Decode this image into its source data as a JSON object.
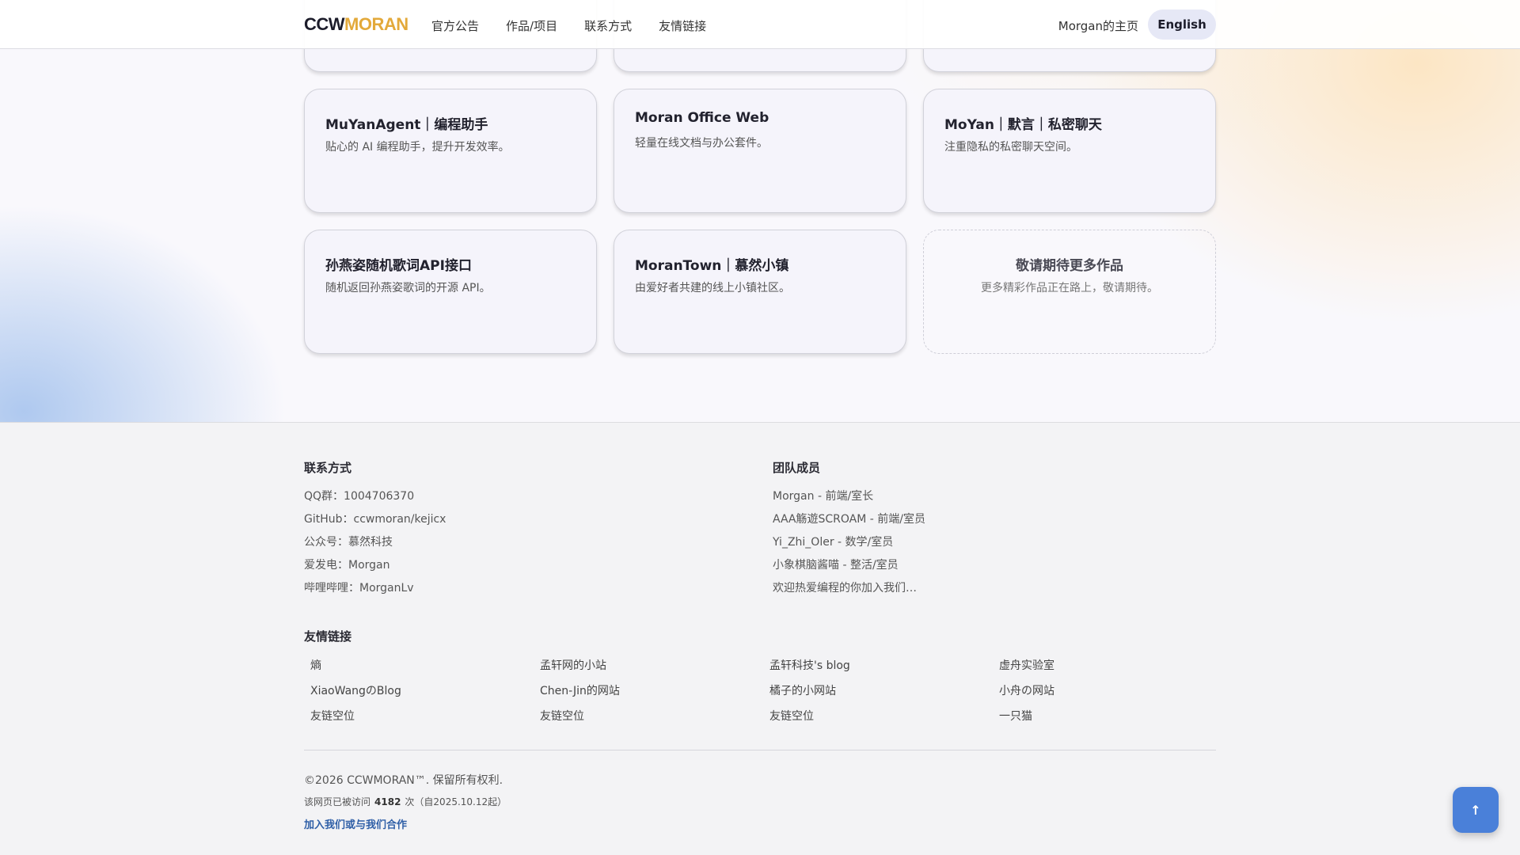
{
  "header": {
    "logo_part1": "CCW",
    "logo_part2": "MORAN",
    "nav": [
      "官方公告",
      "作品/项目",
      "联系方式",
      "友情链接"
    ],
    "home_link": "Morgan的主页",
    "lang_button": "English"
  },
  "projects": [
    {
      "title": "MuYanAgent｜编程助手",
      "desc": "贴心的 AI 编程助手，提升开发效率。"
    },
    {
      "title": "Moran Office Web",
      "desc": "轻量在线文档与办公套件。"
    },
    {
      "title": "MoYan｜默言｜私密聊天",
      "desc": "注重隐私的私密聊天空间。"
    },
    {
      "title": "孙燕姿随机歌词API接口",
      "desc": "随机返回孙燕姿歌词的开源 API。"
    },
    {
      "title": "MoranTown｜慕然小镇",
      "desc": "由爱好者共建的线上小镇社区。"
    },
    {
      "title": "敬请期待更多作品",
      "desc": "更多精彩作品正在路上，敬请期待。"
    }
  ],
  "footer": {
    "contact": {
      "heading": "联系方式",
      "items": [
        "QQ群：1004706370",
        "GitHub：ccwmoran/kejicx",
        "公众号：慕然科技",
        "爱发电：Morgan",
        "哔哩哔哩：MorganLv"
      ]
    },
    "team": {
      "heading": "团队成员",
      "items": [
        "Morgan - 前端/室长",
        "AAA觞遊SCROAM - 前端/室员",
        "Yi_Zhi_Oler - 数学/室员",
        "小象棋脑酱喵 - 整活/室员",
        "欢迎热爱编程的你加入我们…"
      ]
    },
    "friends": {
      "heading": "友情链接",
      "links": [
        "熵",
        "孟轩网的小站",
        "孟轩科技's blog",
        "虚舟实验室",
        "XiaoWangのBlog",
        "Chen-Jin的网站",
        "橘子的小网站",
        "小舟の网站",
        "友链空位",
        "友链空位",
        "友链空位",
        "一只猫"
      ]
    },
    "copyright": "©2026 CCWMORAN™. 保留所有权利.",
    "visits_prefix": "该网页已被访问",
    "visits_count": "4182",
    "visits_suffix": "次（自2025.10.12起）",
    "join_link": "加入我们或与我们合作"
  },
  "back_to_top": "↑"
}
